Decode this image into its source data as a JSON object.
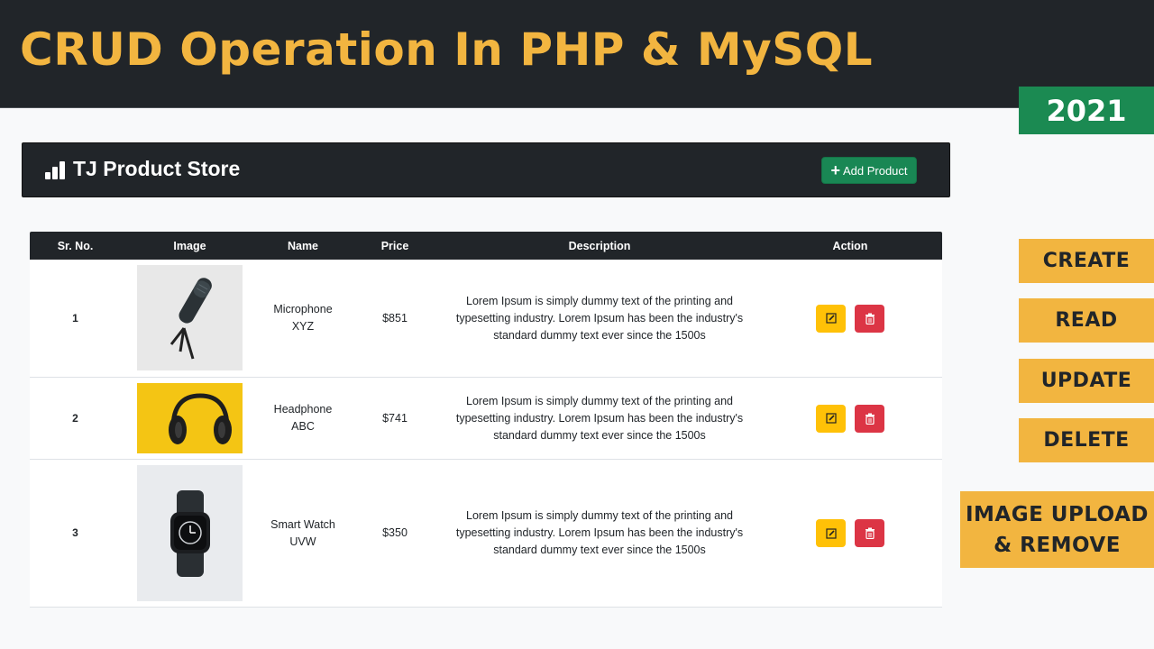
{
  "banner": {
    "title": "CRUD Operation In PHP & MySQL",
    "year": "2021"
  },
  "side_tags": {
    "create": "CREATE",
    "read": "READ",
    "update": "UPDATE",
    "delete": "DELETE",
    "image_line1": "IMAGE UPLOAD",
    "image_line2": "& REMOVE"
  },
  "navbar": {
    "brand": "TJ Product Store",
    "brand_icon": "bar-chart-icon",
    "add_button": "Add Product"
  },
  "table": {
    "headers": {
      "sr": "Sr. No.",
      "image": "Image",
      "name": "Name",
      "price": "Price",
      "description": "Description",
      "action": "Action"
    },
    "rows": [
      {
        "sr": "1",
        "name_line1": "Microphone",
        "name_line2": "XYZ",
        "price": "$851",
        "image": "microphone-photo",
        "desc_line1": "Lorem Ipsum is simply dummy text of the printing and",
        "desc_line2": "typesetting industry. Lorem Ipsum has been the industry's",
        "desc_line3": "standard dummy text ever since the 1500s"
      },
      {
        "sr": "2",
        "name_line1": "Headphone",
        "name_line2": "ABC",
        "price": "$741",
        "image": "headphone-photo",
        "desc_line1": "Lorem Ipsum is simply dummy text of the printing and",
        "desc_line2": "typesetting industry. Lorem Ipsum has been the industry's",
        "desc_line3": "standard dummy text ever since the 1500s"
      },
      {
        "sr": "3",
        "name_line1": "Smart Watch",
        "name_line2": "UVW",
        "price": "$350",
        "image": "smartwatch-photo",
        "desc_line1": "Lorem Ipsum is simply dummy text of the printing and",
        "desc_line2": "typesetting industry. Lorem Ipsum has been the industry's",
        "desc_line3": "standard dummy text ever since the 1500s"
      }
    ]
  },
  "colors": {
    "accent": "#f2b540",
    "dark": "#212529",
    "success": "#198754",
    "warning": "#ffc107",
    "danger": "#dc3545",
    "badge_green": "#1b8a52"
  }
}
